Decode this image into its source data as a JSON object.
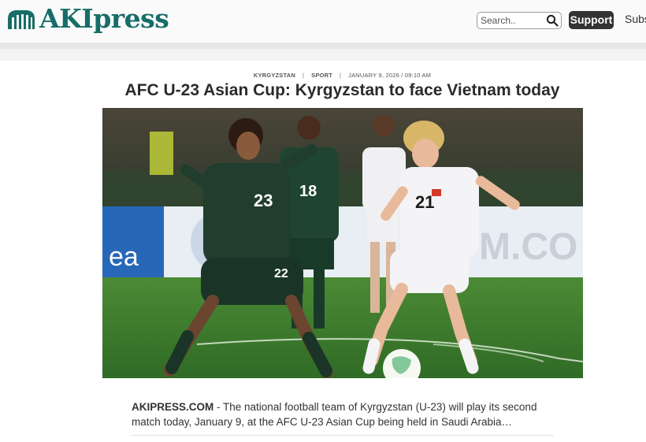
{
  "header": {
    "logo_text": "AKIpress",
    "logo_icon": "akipress-logo-mark",
    "search_placeholder": "Search..",
    "support_label": "Support",
    "subscribe_label": "Subs"
  },
  "article": {
    "category": "KYRGYZSTAN",
    "section": "SPORT",
    "date": "JANUARY 9, 2026 / 09:10 AM",
    "separator": "|",
    "title": "AFC U-23 Asian Cup: Kyrgyzstan to face Vietnam today",
    "source": "AKIPRESS.COM",
    "lead_text": " - The national football team of Kyrgyzstan (U-23) will play its second match today, January 9, at the AFC U-23 Asian Cup being held in Saudi Arabia…"
  },
  "photo": {
    "player_numbers": [
      "23",
      "18",
      "21",
      "22"
    ],
    "ad_board_text": "M.CO",
    "ad_board_left_text": "ea"
  },
  "colors": {
    "brand": "#176d68",
    "support_bg": "#333333",
    "green_kit": "#1e3b2c",
    "white_kit": "#f4f4f6",
    "pitch": "#3d7d2e"
  }
}
